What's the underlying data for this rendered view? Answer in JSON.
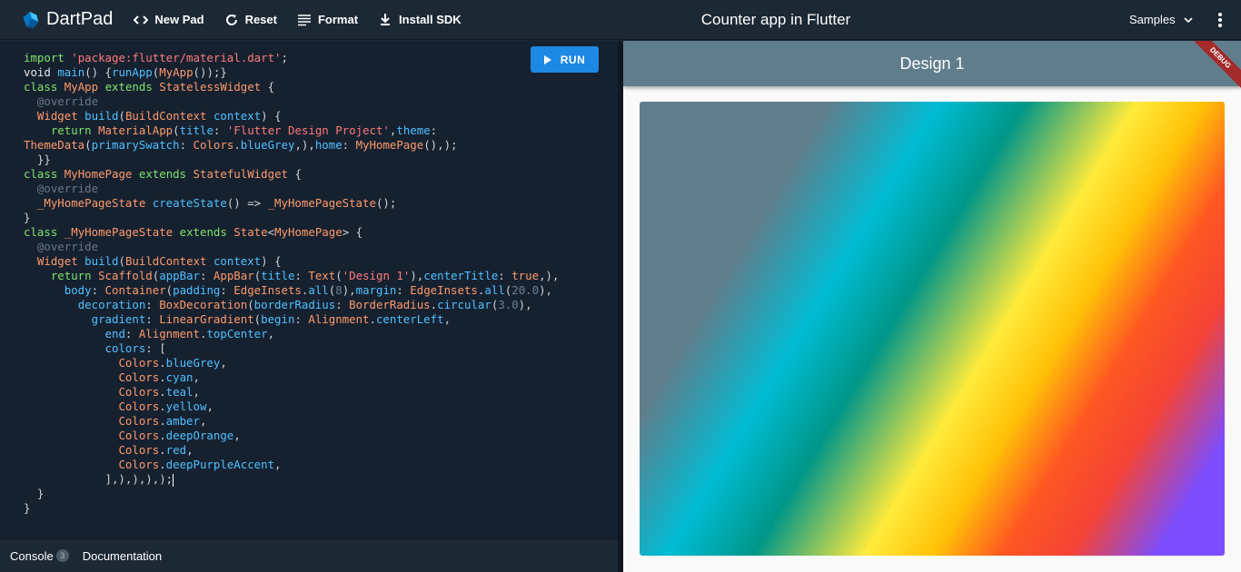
{
  "app": {
    "name": "DartPad",
    "title": "Counter app in Flutter"
  },
  "toolbar": {
    "new_pad": "New Pad",
    "reset": "Reset",
    "format": "Format",
    "install_sdk": "Install SDK",
    "samples": "Samples"
  },
  "editor": {
    "run_label": "RUN"
  },
  "footer": {
    "console": "Console",
    "console_count": "3",
    "documentation": "Documentation"
  },
  "preview": {
    "appbar_title": "Design 1",
    "debug_banner": "DEBUG"
  },
  "colors": {
    "accent": "#1e88e5",
    "appbar": "#607d8b",
    "gradient": [
      "#607d8b",
      "#00bcd4",
      "#009688",
      "#ffeb3b",
      "#ffc107",
      "#ff5722",
      "#f44336",
      "#7c4dff"
    ]
  }
}
